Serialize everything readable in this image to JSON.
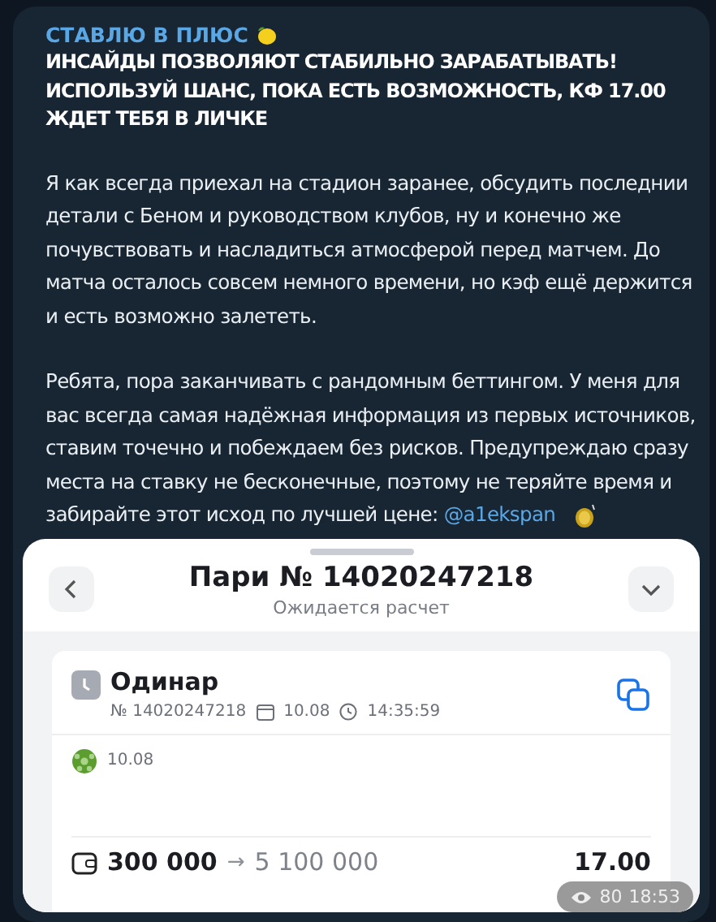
{
  "message": {
    "channel": "СТАВЛЮ В ПЛЮС",
    "headline": "ИНСАЙДЫ ПОЗВОЛЯЮТ СТАБИЛЬНО ЗАРАБАТЫВАТЬ! ИСПОЛЬЗУЙ ШАНС, ПОКА ЕСТЬ ВОЗМОЖНОСТЬ, КФ 17.00 ЖДЕТ ТЕБЯ В ЛИЧКЕ",
    "paragraphs": [
      "Я как всегда приехал на стадион заранее, обсудить последнии детали с Беном и руководством клубов, ну и конечно же почувствовать и насладиться атмосферой перед матчем. До матча осталось совсем немного времени, но кэф ещё держится и есть возможно залететь.",
      "Ребята, пора заканчивать с рандомным беттингом. У меня для вас всегда самая надёжная информация из первых источников, ставим точечно и побеждаем без рисков. Предупреждаю сразу места на ставку не бесконечные, поэтому не теряйте время и забирайте этот исход по лучшей цене:"
    ],
    "link": "@a1ekspan",
    "views": "80",
    "time": "18:53"
  },
  "bet": {
    "title": "Пари № 14020247218",
    "status": "Ожидается расчет",
    "type": "Одинар",
    "number": "№ 14020247218",
    "date": "10.08",
    "time": "14:35:59",
    "event_date": "10.08",
    "stake": "300 000",
    "arrow": "→",
    "payout": "5 100 000",
    "odds": "17.00"
  }
}
